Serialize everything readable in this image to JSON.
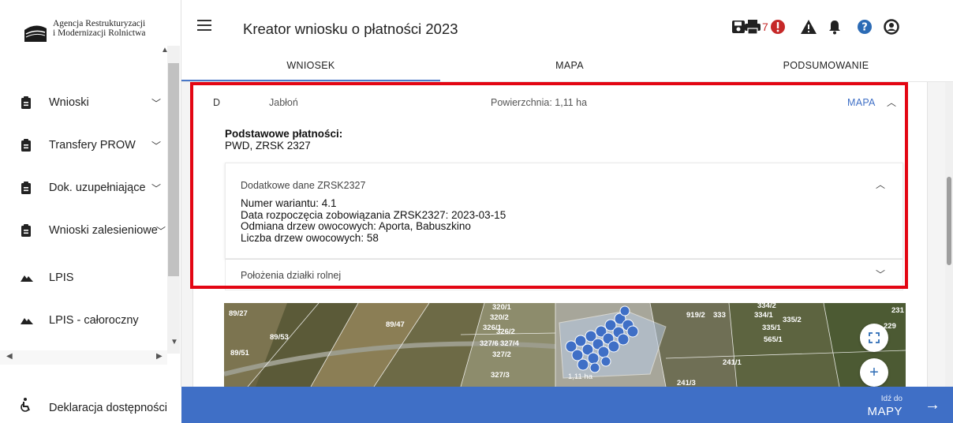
{
  "sidebar": {
    "logo_line1": "Agencja Restrukturyzacji",
    "logo_line2": "i Modernizacji Rolnictwa",
    "items": [
      {
        "label": "Wnioski",
        "icon": "clipboard-icon",
        "has_chevron": true
      },
      {
        "label": "Transfery PROW",
        "icon": "clipboard-icon",
        "has_chevron": true
      },
      {
        "label": "Dok. uzupełniające",
        "icon": "clipboard-icon",
        "has_chevron": true
      },
      {
        "label": "Wnioski zalesieniowe",
        "icon": "clipboard-icon",
        "has_chevron": true
      },
      {
        "label": "LPIS",
        "icon": "mountain-icon",
        "has_chevron": false
      },
      {
        "label": "LPIS - całoroczny",
        "icon": "mountain-icon",
        "has_chevron": false
      }
    ],
    "footer_link": "Deklaracja dostępności"
  },
  "header": {
    "title": "Kreator wniosku o płatności 2023",
    "error_count": "7",
    "icons": [
      "save-icon",
      "print-icon",
      "error-icon",
      "warning-icon",
      "bell-icon",
      "help-icon",
      "account-icon"
    ]
  },
  "tabs": [
    {
      "label": "WNIOSEK",
      "active": true
    },
    {
      "label": "MAPA",
      "active": false
    },
    {
      "label": "PODSUMOWANIE",
      "active": false
    }
  ],
  "parcel": {
    "letter": "D",
    "crop": "Jabłoń",
    "area": "Powierzchnia: 1,11 ha",
    "map_link": "MAPA"
  },
  "basic_payments": {
    "heading": "Podstawowe płatności:",
    "value": "PWD, ZRSK 2327"
  },
  "extra_data": {
    "title": "Dodatkowe dane ZRSK2327",
    "lines": [
      "Numer wariantu: 4.1",
      "Data rozpoczęcia zobowiązania ZRSK2327: 2023-03-15",
      "Odmiana drzew owocowych: Aporta, Babuszkino",
      "Liczba drzew owocowych: 58"
    ]
  },
  "location": {
    "title": "Położenia działki rolnej"
  },
  "map": {
    "labels": [
      "89/27",
      "89/53",
      "89/51",
      "89/47",
      "320/1",
      "320/2",
      "326/1",
      "326/2",
      "327/6",
      "327/4",
      "327/2",
      "327/3",
      "1,11 ha",
      "919/2",
      "333",
      "334/2",
      "334/1",
      "335/2",
      "335/1",
      "565/1",
      "241/1",
      "241/3",
      "231",
      "229"
    ]
  },
  "bottom": {
    "go_small": "Idź do",
    "go_big": "MAPY"
  },
  "colors": {
    "accent": "#3f6fc6",
    "highlight": "#e30613",
    "error": "#c62828",
    "help": "#2c6bb5"
  }
}
